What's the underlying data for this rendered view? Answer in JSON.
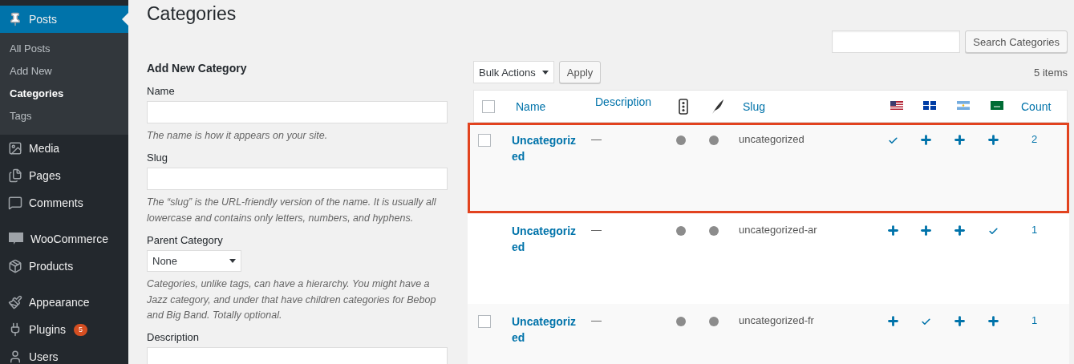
{
  "sidebar": {
    "groups": [
      [
        {
          "label": "Posts",
          "kind": "pin",
          "current": true,
          "children": [
            {
              "label": "All Posts",
              "selected": false
            },
            {
              "label": "Add New",
              "selected": false
            },
            {
              "label": "Categories",
              "selected": true
            },
            {
              "label": "Tags",
              "selected": false
            }
          ]
        },
        {
          "label": "Media",
          "kind": "media",
          "current": false
        },
        {
          "label": "Pages",
          "kind": "pages",
          "current": false
        },
        {
          "label": "Comments",
          "kind": "comments",
          "current": false
        }
      ],
      [
        {
          "label": "WooCommerce",
          "kind": "woo",
          "current": false
        },
        {
          "label": "Products",
          "kind": "box",
          "current": false
        }
      ],
      [
        {
          "label": "Appearance",
          "kind": "brush",
          "current": false
        },
        {
          "label": "Plugins",
          "kind": "plug",
          "current": false,
          "badge": "5"
        },
        {
          "label": "Users",
          "kind": "user",
          "current": false
        }
      ]
    ]
  },
  "page_title": "Categories",
  "search": {
    "button": "Search Categories"
  },
  "form": {
    "title": "Add New Category",
    "fields": [
      {
        "kind": "input",
        "label": "Name",
        "hint": "The name is how it appears on your site."
      },
      {
        "kind": "input",
        "label": "Slug",
        "hint": "The “slug” is the URL-friendly version of the name. It is usually all lowercase and contains only letters, numbers, and hyphens."
      },
      {
        "kind": "select",
        "label": "Parent Category",
        "value": "None",
        "hint": "Categories, unlike tags, can have a hierarchy. You might have a Jazz category, and under that have children categories for Bebop and Big Band. Totally optional."
      },
      {
        "kind": "textarea",
        "label": "Description"
      }
    ]
  },
  "toolbar": {
    "bulk_actions": "Bulk Actions",
    "apply": "Apply",
    "items_count": "5 items"
  },
  "table": {
    "select_all_checked": false,
    "columns": {
      "name": "Name",
      "description": "Description",
      "slug": "Slug",
      "count": "Count"
    },
    "rows": [
      {
        "name": "Uncategorized",
        "description": "—",
        "slug": "uncategorized",
        "count": "2",
        "checked": false,
        "highlighted": true,
        "translations": [
          {
            "translated": true
          },
          {
            "translated": false
          },
          {
            "translated": false
          },
          {
            "translated": false
          }
        ]
      },
      {
        "name": "Uncategorized",
        "description": "—",
        "slug": "uncategorized-ar",
        "count": "1",
        "highlighted": false,
        "translations": [
          {
            "translated": false
          },
          {
            "translated": false
          },
          {
            "translated": false
          },
          {
            "translated": true
          }
        ]
      },
      {
        "name": "Uncategorized",
        "description": "—",
        "slug": "uncategorized-fr",
        "count": "1",
        "checked": false,
        "highlighted": false,
        "translations": [
          {
            "translated": false
          },
          {
            "translated": true
          },
          {
            "translated": false
          },
          {
            "translated": false
          }
        ]
      }
    ]
  }
}
